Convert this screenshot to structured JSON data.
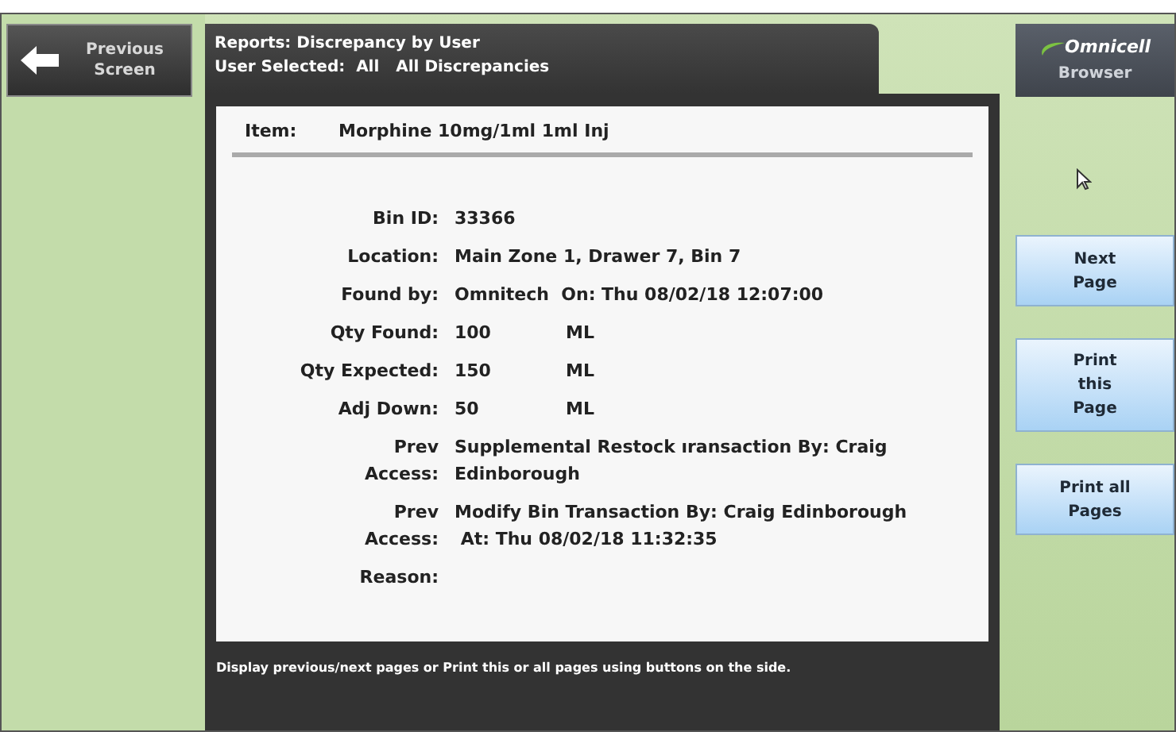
{
  "back_button": {
    "label": [
      "Previous",
      "Screen"
    ]
  },
  "header": {
    "title": "Reports: Discrepancy by User",
    "subtitle": "User Selected:  All   All Discrepancies"
  },
  "item": {
    "label": "Item:",
    "value": "Morphine 10mg/1ml 1ml Inj"
  },
  "fields": [
    {
      "label": [
        "Bin ID:"
      ],
      "value": [
        "33366"
      ]
    },
    {
      "label": [
        "Location:"
      ],
      "value": [
        "Main Zone 1, Drawer 7, Bin 7"
      ]
    },
    {
      "label": [
        "Found by:"
      ],
      "value": [
        "Omnitech  On: Thu 08/02/18 12:07:00"
      ]
    },
    {
      "label": [
        "Qty Found:"
      ],
      "value": [
        "100"
      ],
      "unit": "ML"
    },
    {
      "label": [
        "Qty Expected:"
      ],
      "value": [
        "150"
      ],
      "unit": "ML"
    },
    {
      "label": [
        "Adj Down:"
      ],
      "value": [
        "50"
      ],
      "unit": "ML"
    },
    {
      "label": [
        "Prev",
        "Access:"
      ],
      "value": [
        "Supplemental Restock ıransaction By: Craig",
        "Edinborough"
      ]
    },
    {
      "label": [
        "Prev",
        "Access:"
      ],
      "value": [
        "Modify Bin Transaction By: Craig Edinborough",
        " At: Thu 08/02/18 11:32:35"
      ]
    },
    {
      "label": [
        "Reason:"
      ]
    }
  ],
  "footer": "Display previous/next pages or Print this or all pages using buttons on the side.",
  "brand": {
    "logo": "Omnicell",
    "label": "Browser"
  },
  "side_buttons": [
    {
      "label": [
        "Next",
        "Page"
      ]
    },
    {
      "label": [
        "Print",
        "this",
        "Page"
      ]
    },
    {
      "label": [
        "Print all",
        "Pages"
      ]
    }
  ]
}
